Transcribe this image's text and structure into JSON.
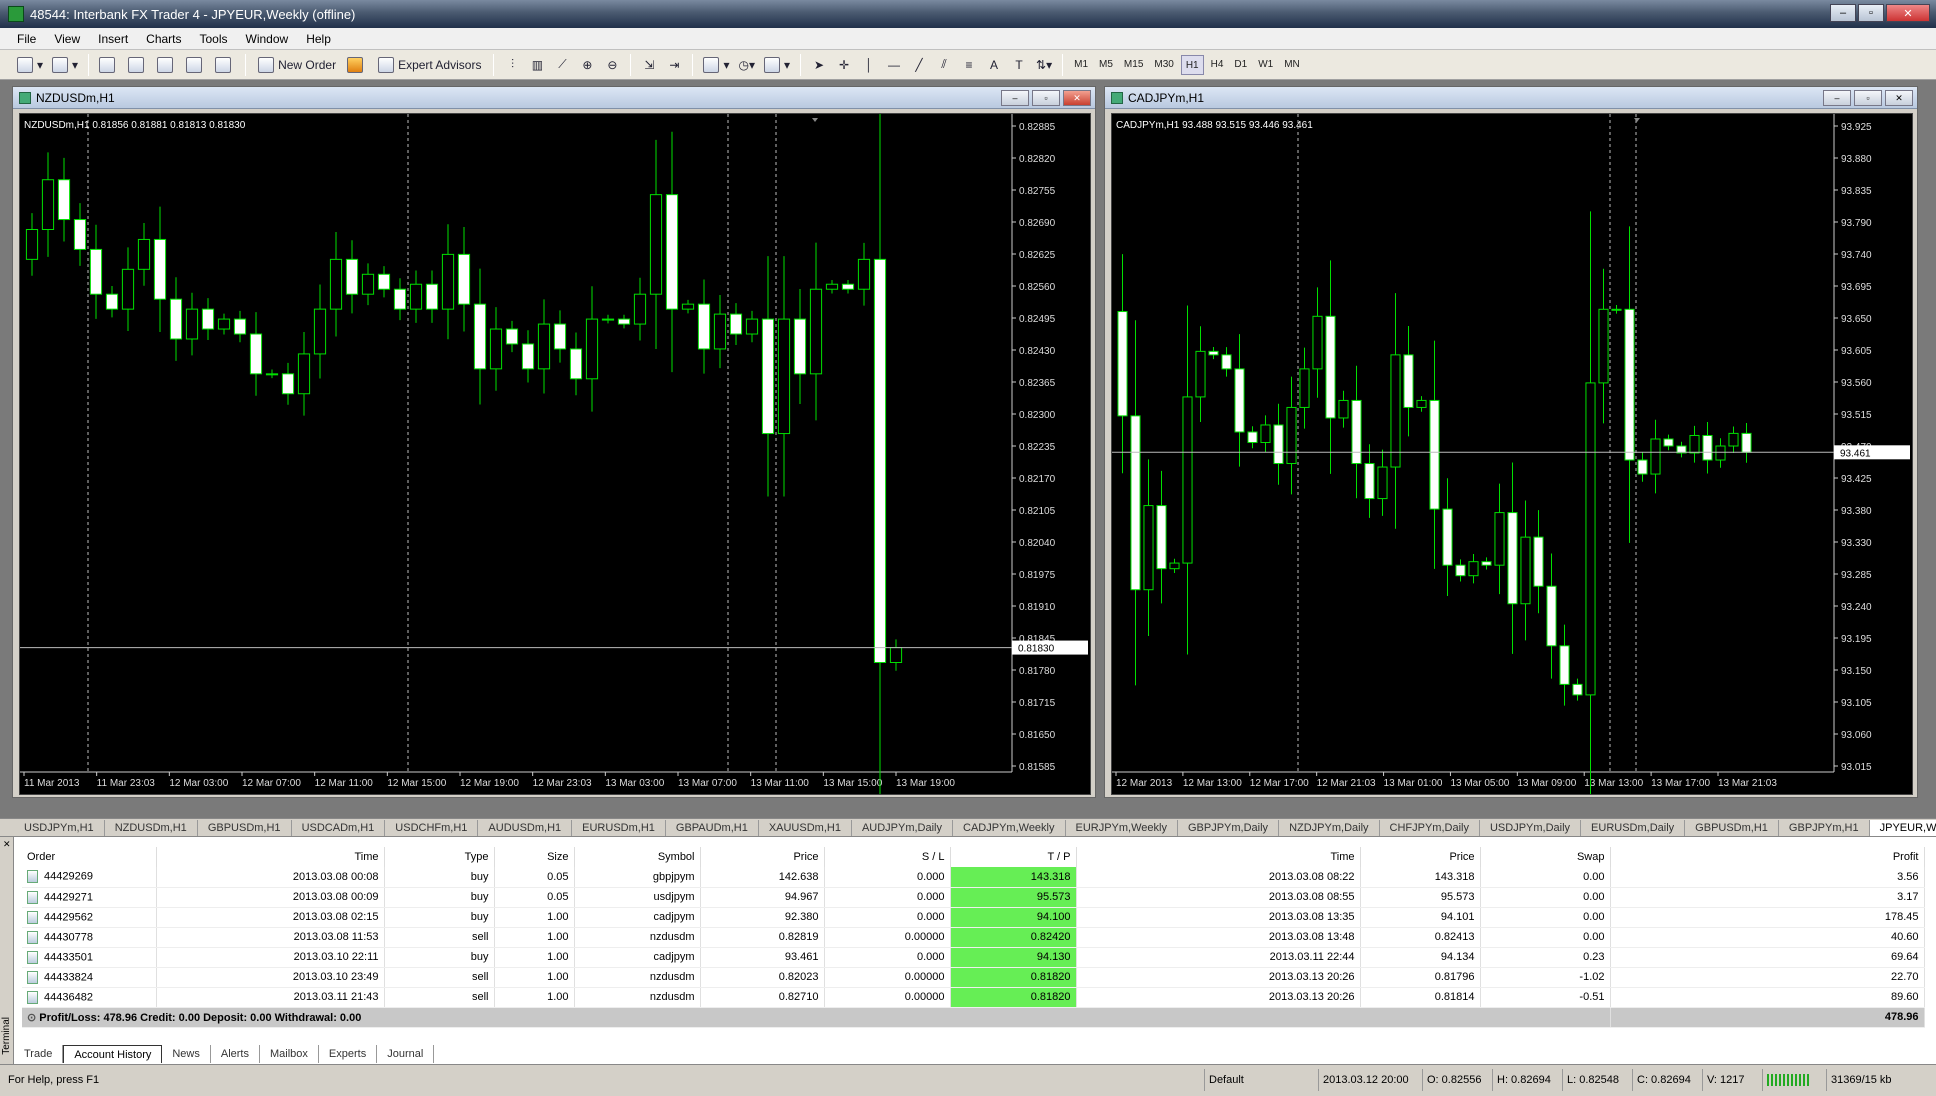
{
  "app": {
    "title": "48544: Interbank FX Trader 4 - JPYEUR,Weekly (offline)",
    "controls": {
      "minimize": "–",
      "restore": "▫",
      "close": "✕"
    }
  },
  "menu": [
    "File",
    "View",
    "Insert",
    "Charts",
    "Tools",
    "Window",
    "Help"
  ],
  "toolbar": {
    "new_order": "New Order",
    "expert_advisors": "Expert Advisors",
    "timeframes": [
      "M1",
      "M5",
      "M15",
      "M30",
      "H1",
      "H4",
      "D1",
      "W1",
      "MN"
    ],
    "active_timeframe": "H1"
  },
  "chart_data": [
    {
      "type": "candlestick",
      "window_title": "NZDUSDm,H1",
      "info": "NZDUSDm,H1  0.81856 0.81881 0.81813 0.81830",
      "ylim": [
        0.8158,
        0.8289
      ],
      "y_ticks": [
        "0.82885",
        "0.82820",
        "0.82755",
        "0.82690",
        "0.82625",
        "0.82560",
        "0.82495",
        "0.82430",
        "0.82365",
        "0.82300",
        "0.82235",
        "0.82170",
        "0.82105",
        "0.82040",
        "0.81975",
        "0.81910",
        "0.81845",
        "0.81780",
        "0.81715",
        "0.81650",
        "0.81585"
      ],
      "x_labels": [
        "11 Mar 2013",
        "11 Mar 23:03",
        "12 Mar 03:00",
        "12 Mar 07:00",
        "12 Mar 11:00",
        "12 Mar 15:00",
        "12 Mar 19:00",
        "12 Mar 23:03",
        "13 Mar 03:00",
        "13 Mar 07:00",
        "13 Mar 11:00",
        "13 Mar 15:00",
        "13 Mar 19:00"
      ],
      "current_price": "0.81830",
      "current_value": 0.8183,
      "separators_at": [
        4,
        24,
        44,
        47
      ],
      "close": [
        0.8267,
        0.8277,
        0.8269,
        0.8263,
        0.8254,
        0.8251,
        0.8259,
        0.8265,
        0.8253,
        0.8245,
        0.8251,
        0.8247,
        0.8249,
        0.8246,
        0.8238,
        0.8238,
        0.8234,
        0.8242,
        0.8251,
        0.8261,
        0.8254,
        0.8258,
        0.8255,
        0.8251,
        0.8256,
        0.8251,
        0.8262,
        0.8252,
        0.8239,
        0.8247,
        0.8244,
        0.8239,
        0.8248,
        0.8243,
        0.8237,
        0.8249,
        0.8249,
        0.8248,
        0.8254,
        0.8274,
        0.8251,
        0.8252,
        0.8243,
        0.825,
        0.8246,
        0.8249,
        0.8226,
        0.8249,
        0.8238,
        0.8255,
        0.8256,
        0.8255,
        0.8261,
        0.818,
        0.8183
      ]
    },
    {
      "type": "candlestick",
      "window_title": "CADJPYm,H1",
      "info": "CADJPYm,H1  93.488 93.515 93.446 93.461",
      "ylim": [
        93.005,
        93.935
      ],
      "y_ticks": [
        "93.925",
        "93.880",
        "93.835",
        "93.790",
        "93.740",
        "93.695",
        "93.650",
        "93.605",
        "93.560",
        "93.515",
        "93.470",
        "93.425",
        "93.380",
        "93.330",
        "93.285",
        "93.240",
        "93.195",
        "93.150",
        "93.105",
        "93.060",
        "93.015"
      ],
      "x_labels": [
        "12 Mar 2013",
        "12 Mar 13:00",
        "12 Mar 17:00",
        "12 Mar 21:03",
        "13 Mar 01:00",
        "13 Mar 05:00",
        "13 Mar 09:00",
        "13 Mar 13:00",
        "13 Mar 17:00",
        "13 Mar 21:03"
      ],
      "current_price": "93.461",
      "current_value": 93.461,
      "separators_at": [
        14,
        38,
        40
      ],
      "close": [
        93.513,
        93.265,
        93.385,
        93.295,
        93.303,
        93.54,
        93.605,
        93.6,
        93.58,
        93.49,
        93.475,
        93.5,
        93.445,
        93.525,
        93.58,
        93.655,
        93.51,
        93.535,
        93.445,
        93.395,
        93.44,
        93.6,
        93.525,
        93.535,
        93.38,
        93.3,
        93.285,
        93.305,
        93.3,
        93.375,
        93.245,
        93.34,
        93.27,
        93.185,
        93.13,
        93.115,
        93.56,
        93.665,
        93.665,
        93.45,
        93.43,
        93.48,
        93.47,
        93.46,
        93.485,
        93.45,
        93.47,
        93.488,
        93.461
      ]
    }
  ],
  "symbol_tabs": [
    "USDJPYm,H1",
    "NZDUSDm,H1",
    "GBPUSDm,H1",
    "USDCADm,H1",
    "USDCHFm,H1",
    "AUDUSDm,H1",
    "EURUSDm,H1",
    "GBPAUDm,H1",
    "XAUUSDm,H1",
    "AUDJPYm,Daily",
    "CADJPYm,Weekly",
    "EURJPYm,Weekly",
    "GBPJPYm,Daily",
    "NZDJPYm,Daily",
    "CHFJPYm,Daily",
    "USDJPYm,Daily",
    "EURUSDm,Daily",
    "GBPUSDm,H1",
    "GBPJPYm,H1",
    "JPYEUR,Weekly (offline)"
  ],
  "terminal": {
    "side_label": "Terminal",
    "headers": {
      "order": "Order",
      "time": "Time",
      "type": "Type",
      "size": "Size",
      "symbol": "Symbol",
      "price": "Price",
      "sl": "S / L",
      "tp": "T / P",
      "close_time": "Time",
      "close_price": "Price",
      "swap": "Swap",
      "profit": "Profit"
    },
    "rows": [
      {
        "order": "44429269",
        "time": "2013.03.08 00:08",
        "type": "buy",
        "size": "0.05",
        "symbol": "gbpjpym",
        "price": "142.638",
        "sl": "0.000",
        "tp": "143.318",
        "close_time": "2013.03.08 08:22",
        "close_price": "143.318",
        "swap": "0.00",
        "profit": "3.56"
      },
      {
        "order": "44429271",
        "time": "2013.03.08 00:09",
        "type": "buy",
        "size": "0.05",
        "symbol": "usdjpym",
        "price": "94.967",
        "sl": "0.000",
        "tp": "95.573",
        "close_time": "2013.03.08 08:55",
        "close_price": "95.573",
        "swap": "0.00",
        "profit": "3.17"
      },
      {
        "order": "44429562",
        "time": "2013.03.08 02:15",
        "type": "buy",
        "size": "1.00",
        "symbol": "cadjpym",
        "price": "92.380",
        "sl": "0.000",
        "tp": "94.100",
        "close_time": "2013.03.08 13:35",
        "close_price": "94.101",
        "swap": "0.00",
        "profit": "178.45"
      },
      {
        "order": "44430778",
        "time": "2013.03.08 11:53",
        "type": "sell",
        "size": "1.00",
        "symbol": "nzdusdm",
        "price": "0.82819",
        "sl": "0.00000",
        "tp": "0.82420",
        "close_time": "2013.03.08 13:48",
        "close_price": "0.82413",
        "swap": "0.00",
        "profit": "40.60"
      },
      {
        "order": "44433501",
        "time": "2013.03.10 22:11",
        "type": "buy",
        "size": "1.00",
        "symbol": "cadjpym",
        "price": "93.461",
        "sl": "0.000",
        "tp": "94.130",
        "close_time": "2013.03.11 22:44",
        "close_price": "94.134",
        "swap": "0.23",
        "profit": "69.64"
      },
      {
        "order": "44433824",
        "time": "2013.03.10 23:49",
        "type": "sell",
        "size": "1.00",
        "symbol": "nzdusdm",
        "price": "0.82023",
        "sl": "0.00000",
        "tp": "0.81820",
        "close_time": "2013.03.13 20:26",
        "close_price": "0.81796",
        "swap": "-1.02",
        "profit": "22.70"
      },
      {
        "order": "44436482",
        "time": "2013.03.11 21:43",
        "type": "sell",
        "size": "1.00",
        "symbol": "nzdusdm",
        "price": "0.82710",
        "sl": "0.00000",
        "tp": "0.81820",
        "close_time": "2013.03.13 20:26",
        "close_price": "0.81814",
        "swap": "-0.51",
        "profit": "89.60"
      }
    ],
    "summary": "Profit/Loss: 478.96  Credit: 0.00  Deposit: 0.00  Withdrawal: 0.00",
    "summary_total": "478.96",
    "tabs": [
      "Trade",
      "Account History",
      "News",
      "Alerts",
      "Mailbox",
      "Experts",
      "Journal"
    ],
    "active_tab": "Account History"
  },
  "statusbar": {
    "help": "For Help, press F1",
    "profile": "Default",
    "datetime": "2013.03.12 20:00",
    "open": "O: 0.82556",
    "high": "H: 0.82694",
    "low": "L: 0.82548",
    "close": "C: 0.82694",
    "volume": "V: 1217",
    "traffic": "31369/15 kb"
  }
}
